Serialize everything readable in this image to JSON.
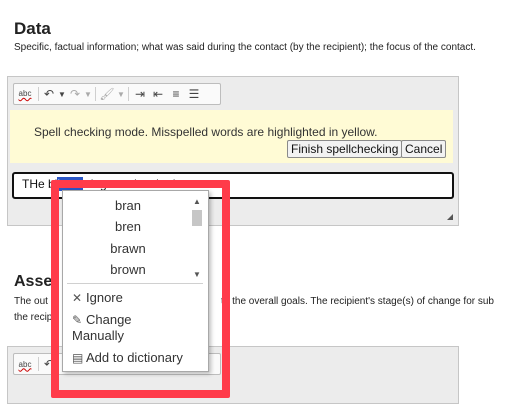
{
  "section1": {
    "title": "Data",
    "description": "Specific, factual information; what was said during the contact (by the recipient); the focus of the contact."
  },
  "toolbar": {
    "spell": "abc",
    "undo": "↶",
    "redo": "↷",
    "format": "🖌",
    "indent": "⇥",
    "outdent": "⇤",
    "ordered_list": "≡",
    "bullet_list": "☰"
  },
  "spellcheck": {
    "banner": "Spell checking mode. Misspelled words are highlighted in yellow.",
    "finish_label": "Finish spellchecking",
    "cancel_label": "Cancel"
  },
  "textbox": {
    "before": "THe bi",
    "selected": "brwn",
    "after": " dog needs a bath"
  },
  "section2": {
    "title_partial": "Asse",
    "desc_line1_left": "The out",
    "desc_line1_right": "to the overall goals. The recipient's stage(s) of change for sub",
    "desc_line2_left": "the recip"
  },
  "context_menu": {
    "suggestions": [
      "bran",
      "bren",
      "brawn",
      "brown"
    ],
    "ignore": "Ignore",
    "change_manually": "Change Manually",
    "change_line1": "Change",
    "change_line2": "Manually",
    "add_dictionary": "Add to dictionary"
  },
  "colors": {
    "highlight_border": "#ff3b4a",
    "banner_bg": "#fffbd5",
    "selection": "#2b56c6"
  }
}
